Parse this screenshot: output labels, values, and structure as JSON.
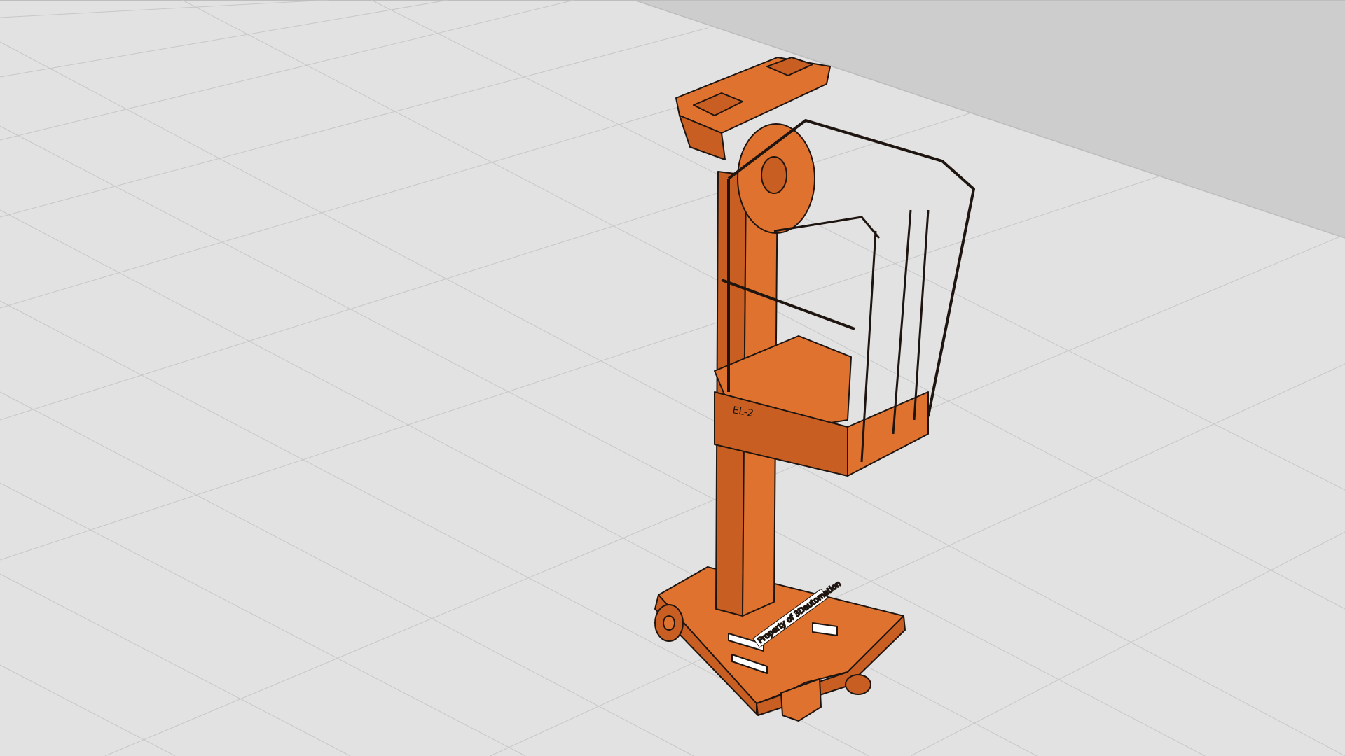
{
  "viewer": {
    "background_color": "#e2e2e2",
    "wall_color": "#cdcdcd",
    "grid_line_color": "#c7c7c7"
  },
  "model": {
    "body_color": "#e0722f",
    "shade_color": "#c95e22",
    "outline_color": "#1e1410",
    "decal_text": "Property of 3Dautomation",
    "brand_mark_text": "EL-2"
  }
}
